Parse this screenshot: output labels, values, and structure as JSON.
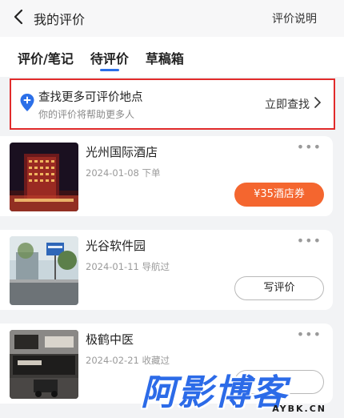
{
  "header": {
    "title": "我的评价",
    "help_link": "评价说明"
  },
  "tabs": [
    {
      "label": "评价/笔记",
      "active": false
    },
    {
      "label": "待评价",
      "active": true
    },
    {
      "label": "草稿箱",
      "active": false
    }
  ],
  "find_more": {
    "title": "查找更多可评价地点",
    "subtitle": "你的评价将帮助更多人",
    "action": "立即查找"
  },
  "places": [
    {
      "name": "光州国际酒店",
      "meta": "2024-01-08 下单",
      "button": "¥35酒店券",
      "button_style": "coupon"
    },
    {
      "name": "光谷软件园",
      "meta": "2024-01-11 导航过",
      "button": "写评价",
      "button_style": "outline"
    },
    {
      "name": "极鹤中医",
      "meta": "2024-02-21 收藏过",
      "button": "",
      "button_style": "outline"
    }
  ],
  "watermark": {
    "main": "阿影博客",
    "sub": "AYBK.CN"
  },
  "colors": {
    "accent": "#2b6fe8",
    "coupon": "#f4662f",
    "highlight_border": "#e12b2b"
  }
}
